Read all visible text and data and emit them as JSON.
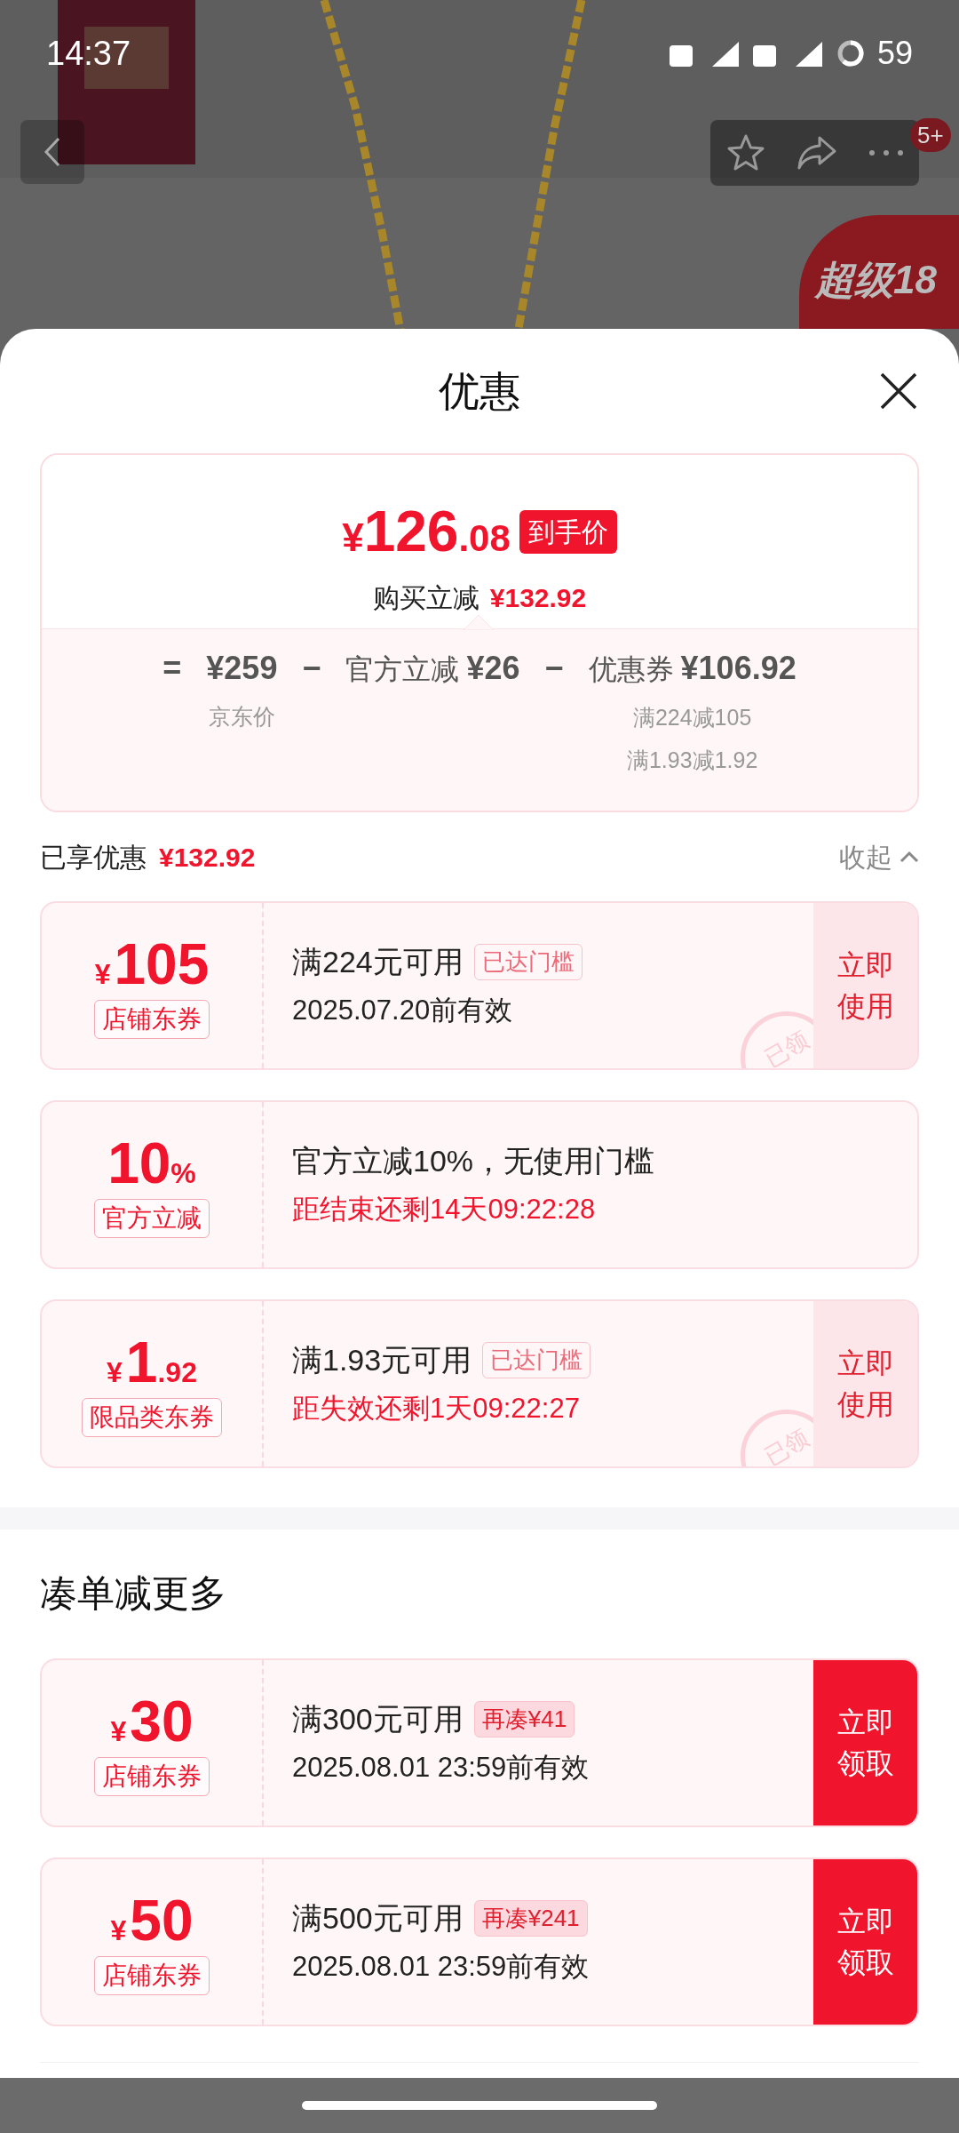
{
  "status_bar": {
    "time": "14:37",
    "battery": "59"
  },
  "header": {
    "badge": "5+",
    "promo": "超级18"
  },
  "sheet": {
    "title": "优惠",
    "summary": {
      "currency": "¥",
      "integer": "126",
      "decimal": ".08",
      "price_tag": "到手价",
      "saving_label": "购买立减",
      "saving": "¥132.92",
      "formula": [
        {
          "kind": "operator",
          "symbol": "="
        },
        {
          "kind": "term",
          "amount": "¥259",
          "notes": [
            "京东价"
          ]
        },
        {
          "kind": "operator",
          "symbol": "−"
        },
        {
          "kind": "term",
          "label": "官方立减",
          "amount": "¥26"
        },
        {
          "kind": "operator",
          "symbol": "−"
        },
        {
          "kind": "term",
          "label": "优惠券",
          "amount": "¥106.92",
          "notes": [
            "满224减105",
            "满1.93减1.92"
          ]
        }
      ]
    },
    "enjoyed": {
      "label": "已享优惠",
      "amount": "¥132.92",
      "toggle": "收起",
      "expanded": true
    },
    "coupons": [
      {
        "prefix": "¥",
        "value": "105",
        "type_tag": "店铺东券",
        "condition": "满224元可用",
        "tag": {
          "text": "已达门槛",
          "kind": "reached"
        },
        "validity": "2025.07.20前有效",
        "urgent": false,
        "action": {
          "text": "立即使用",
          "kind": "use"
        },
        "stamp": "已领"
      },
      {
        "value": "10",
        "suffix": "%",
        "type_tag": "官方立减",
        "condition": "官方立减10%，无使用门槛",
        "validity": "距结束还剩14天09:22:28",
        "urgent": true
      },
      {
        "prefix": "¥",
        "value": "1",
        "suffix": ".92",
        "type_tag": "限品类东券",
        "condition": "满1.93元可用",
        "tag": {
          "text": "已达门槛",
          "kind": "reached"
        },
        "validity": "距失效还剩1天09:22:27",
        "urgent": true,
        "action": {
          "text": "立即使用",
          "kind": "use"
        },
        "stamp": "已领"
      }
    ],
    "more_title": "凑单减更多",
    "more_coupons": [
      {
        "prefix": "¥",
        "value": "30",
        "type_tag": "店铺东券",
        "condition": "满300元可用",
        "tag": {
          "text": "再凑¥41",
          "kind": "gap"
        },
        "validity": "2025.08.01 23:59前有效",
        "urgent": false,
        "action": {
          "text": "立即领取",
          "kind": "claim"
        }
      },
      {
        "prefix": "¥",
        "value": "50",
        "type_tag": "店铺东券",
        "condition": "满500元可用",
        "tag": {
          "text": "再凑¥241",
          "kind": "gap"
        },
        "validity": "2025.08.01 23:59前有效",
        "urgent": false,
        "action": {
          "text": "立即领取",
          "kind": "claim"
        }
      }
    ]
  }
}
